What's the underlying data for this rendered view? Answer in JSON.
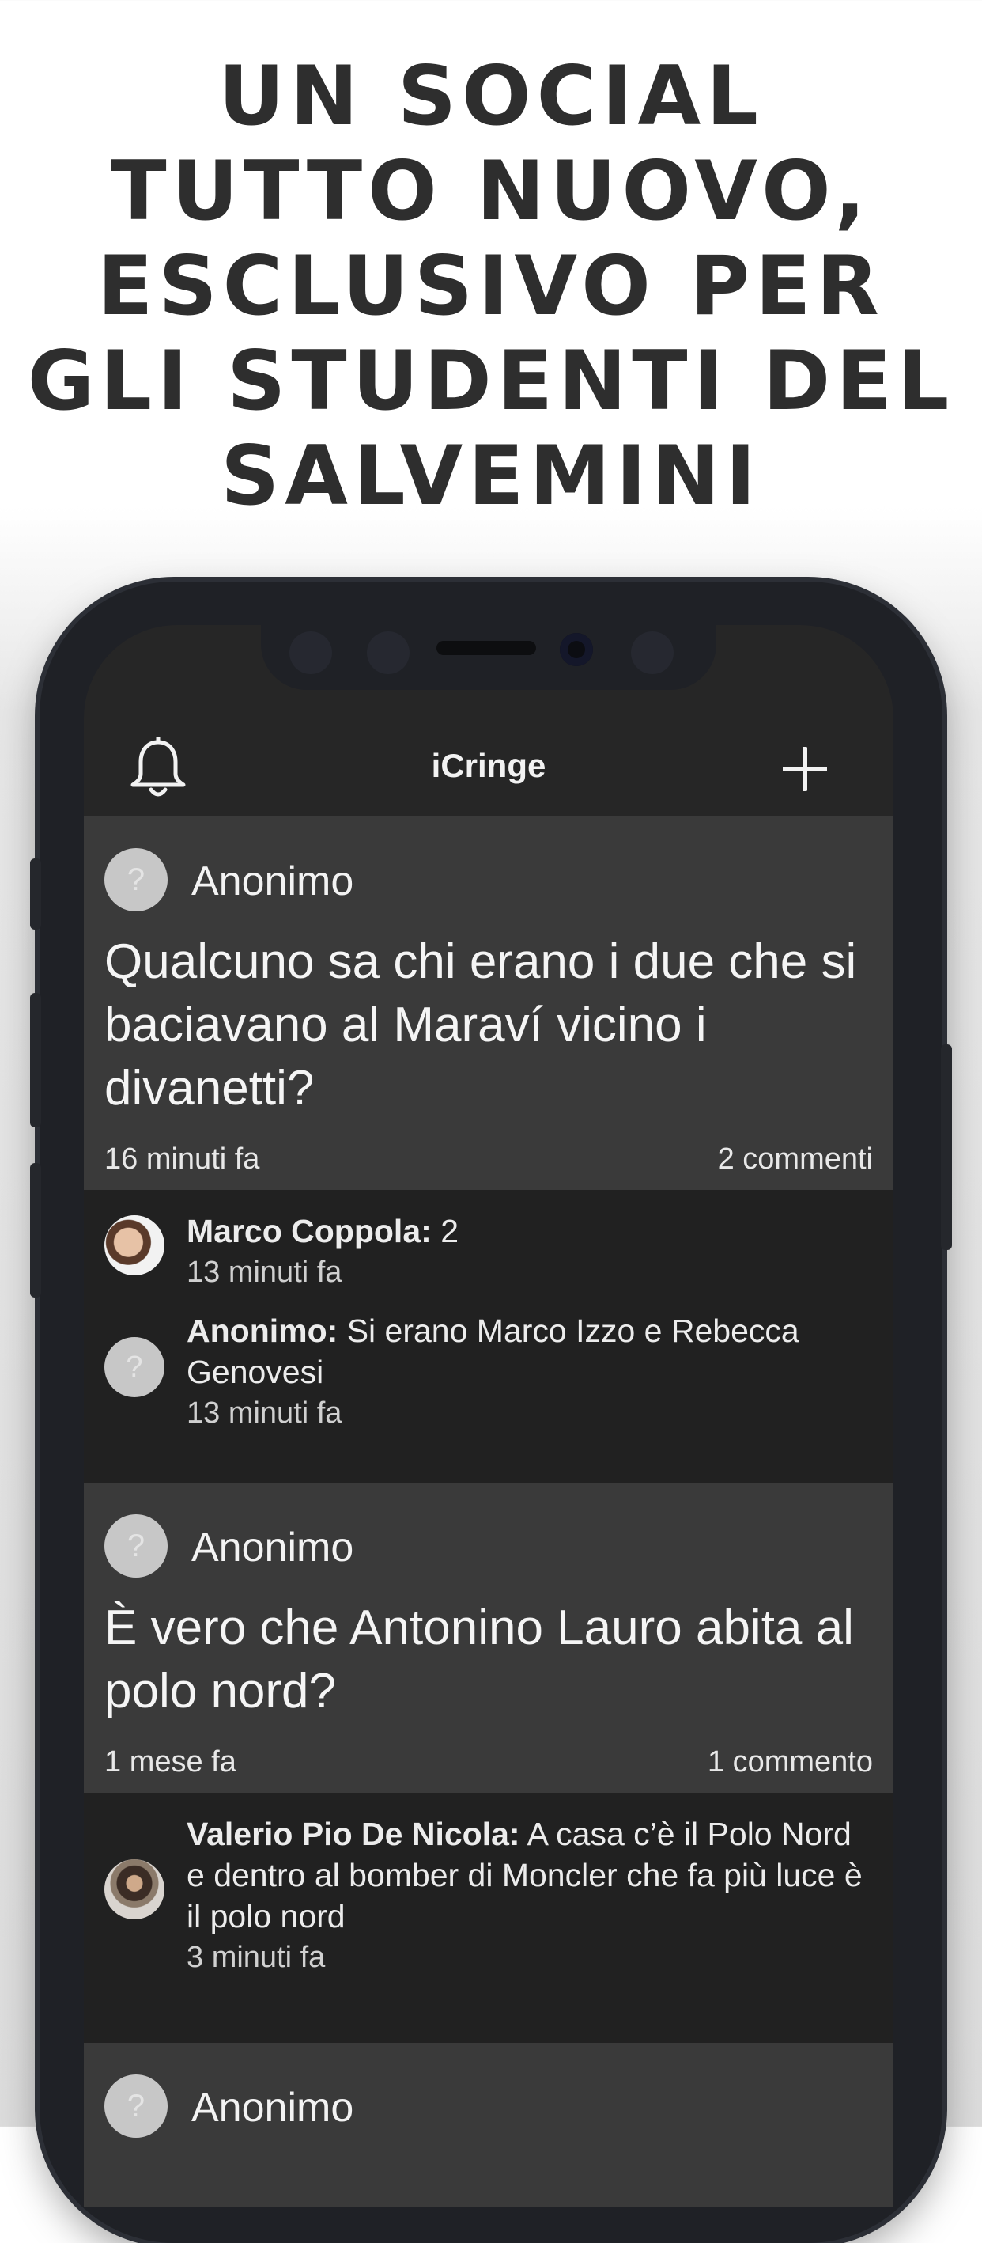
{
  "headline": [
    "UN SOCIAL",
    "TUTTO NUOVO,",
    "ESCLUSIVO PER",
    "GLI STUDENTI DEL",
    "SALVEMINI"
  ],
  "app": {
    "title": "iCringe",
    "left_icon": "bell-icon",
    "right_icon": "plus-icon"
  },
  "colors": {
    "screen_bg": "#262626",
    "post_bg": "#3a3a3a",
    "comment_bg": "#212121",
    "text": "#f2f2f2"
  },
  "posts": [
    {
      "author": "Anonimo",
      "avatar_glyph": "?",
      "text": "Qualcuno sa chi erano i due che si baciavano al Maraví vicino i divanetti?",
      "time": "16 minuti fa",
      "comments_count": "2 commenti",
      "comments": [
        {
          "name": "Marco Coppola:",
          "text": " 2",
          "time": "13 minuti fa",
          "avatar": "photo"
        },
        {
          "name": "Anonimo:",
          "text": " Si erano Marco Izzo e Rebecca Genovesi",
          "time": "13 minuti fa",
          "avatar": "?"
        }
      ]
    },
    {
      "author": "Anonimo",
      "avatar_glyph": "?",
      "text": "È vero che Antonino Lauro abita al polo nord?",
      "time": "1 mese fa",
      "comments_count": "1 commento",
      "comments": [
        {
          "name": "Valerio Pio De Nicola:",
          "text": " A casa c’è il Polo Nord e dentro al bomber di Moncler che fa più luce è il polo nord",
          "time": "3 minuti fa",
          "avatar": "photo"
        }
      ]
    },
    {
      "author": "Anonimo",
      "avatar_glyph": "?"
    }
  ]
}
